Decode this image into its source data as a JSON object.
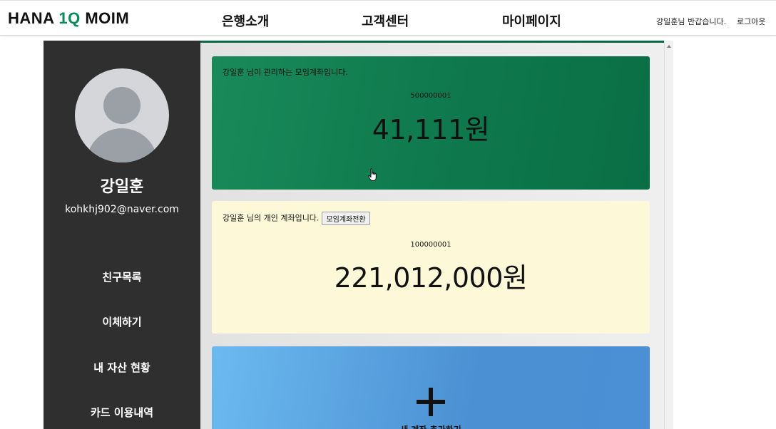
{
  "header": {
    "logo": {
      "part1": "HANA ",
      "accent": "1Q",
      "part2": " MOIM"
    },
    "nav": [
      "은행소개",
      "고객센터",
      "마이페이지"
    ],
    "greeting": "강일훈님 반갑습니다.",
    "logout": "로그아웃"
  },
  "sidebar": {
    "name": "강일훈",
    "email": "kohkhj902@naver.com",
    "menu": [
      "친구목록",
      "이체하기",
      "내 자산 현황",
      "카드 이용내역"
    ]
  },
  "cards": {
    "group": {
      "title": "강일훈 님이 관리하는 모임계좌입니다.",
      "account_no": "500000001",
      "balance": "41,111원"
    },
    "personal": {
      "title": "강일훈 님의 개인 계좌입니다.",
      "switch_button": "모임계좌전환",
      "account_no": "100000001",
      "balance": "221,012,000원"
    },
    "add": {
      "label": "새 계좌 추가하기"
    }
  },
  "colors": {
    "brand_green": "#0a8a5a",
    "group_card": "#11804f",
    "personal_card": "#fdf8d8",
    "add_card": "#5aa3e0",
    "sidebar_bg": "#2f2f2f"
  },
  "icons": {
    "avatar": "user-avatar-icon",
    "add": "plus-icon",
    "cursor": "hand-pointer-icon"
  }
}
